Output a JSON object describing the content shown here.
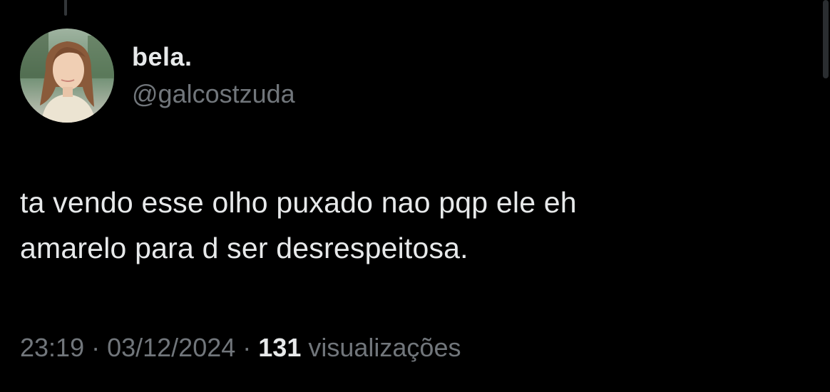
{
  "tweet": {
    "author": {
      "display_name": "bela.",
      "handle": "@galcostzuda",
      "avatar": "profile-photo"
    },
    "text": "ta vendo esse olho puxado nao pqp ele eh\namarelo para d ser desrespeitosa.",
    "time": "23:19",
    "date": "03/12/2024",
    "separator": "·",
    "views_count": "131",
    "views_label": "visualizações"
  },
  "colors": {
    "background": "#000000",
    "primary_text": "#e7e9ea",
    "secondary_text": "#71767b"
  }
}
